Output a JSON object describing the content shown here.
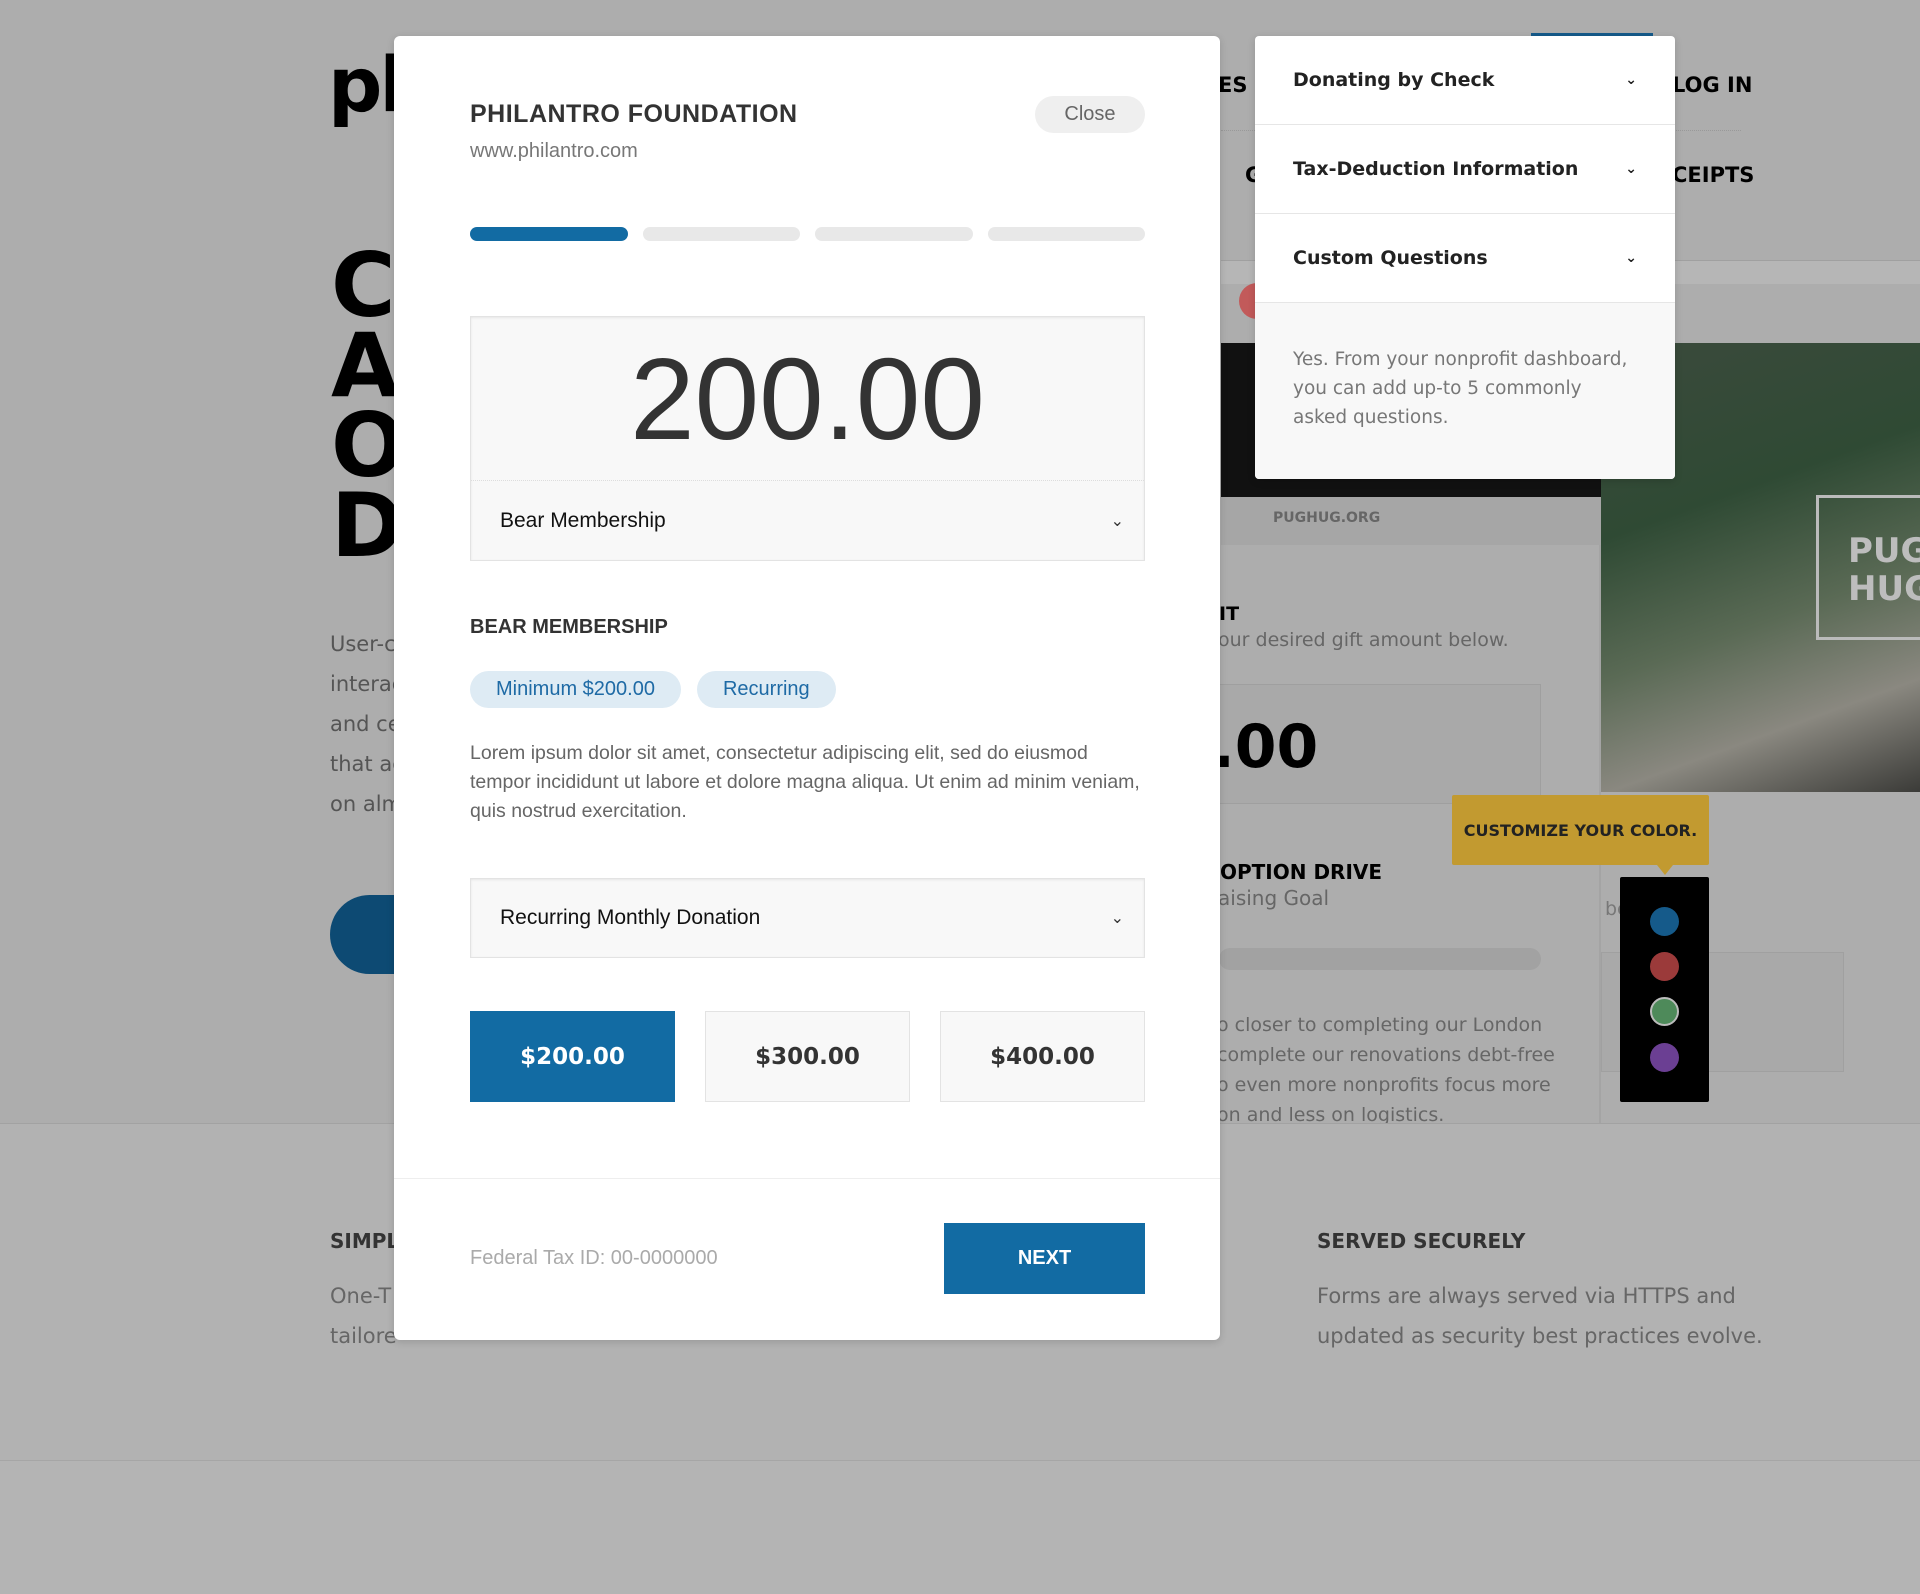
{
  "background": {
    "logo": "ph",
    "nav": {
      "item_partial": "ES",
      "login": "LOG IN",
      "row2_left": "G",
      "row2_right": "CEIPTS"
    },
    "hero_lines": [
      "C",
      "A",
      "O",
      "D"
    ],
    "hero_paragraph": [
      "User-c",
      "interac",
      "and ce",
      "that ac",
      "on alm"
    ],
    "demo": {
      "site": "PUGHUG.ORG",
      "heading_partial": "IT",
      "subheading": "our desired gift amount below.",
      "amount_partial": ".00",
      "drive_title": "OPTION DRIVE",
      "drive_sub": "aising Goal",
      "body_lines": [
        "o closer to completing our London",
        "complete our renovations debt-free",
        "o even more nonprofits focus more",
        "on and less on logistics."
      ],
      "photo_text": [
        "PUG",
        "HUG"
      ],
      "side_text": "be"
    },
    "tooltip": "CUSTOMIZE YOUR COLOR.",
    "palette": [
      "#155a8a",
      "#9b3a3a",
      "#4e8a5a",
      "#6b3f93"
    ],
    "features": [
      {
        "title": "SIMPL",
        "lines": [
          "One-T",
          "tailore"
        ]
      },
      {
        "title": "SERVED SECURELY",
        "lines": [
          "Forms are always served via HTTPS and",
          "updated as security best practices evolve."
        ]
      }
    ]
  },
  "modal": {
    "title": "PHILANTRO FOUNDATION",
    "url": "www.philantro.com",
    "close_label": "Close",
    "progress": {
      "current_step": 1,
      "total_steps": 4
    },
    "amount": "200.00",
    "membership_select": "Bear Membership",
    "section_title": "BEAR MEMBERSHIP",
    "chips": [
      "Minimum $200.00",
      "Recurring"
    ],
    "description": "Lorem ipsum dolor sit amet, consectetur adipiscing elit, sed do eiusmod tempor incididunt ut labore et dolore magna aliqua. Ut enim ad minim veniam, quis nostrud exercitation.",
    "frequency_select": "Recurring Monthly Donation",
    "amount_options": [
      "$200.00",
      "$300.00",
      "$400.00"
    ],
    "selected_amount": "$200.00",
    "tax_id": "Federal Tax ID: 00-0000000",
    "next_label": "NEXT",
    "accent": "#126ba3"
  },
  "faq": {
    "items": [
      "Donating by Check",
      "Tax-Deduction Information",
      "Custom Questions"
    ],
    "open_item": "Custom Questions",
    "answer": "Yes. From your nonprofit dashboard, you can add up-to 5 commonly asked questions."
  }
}
